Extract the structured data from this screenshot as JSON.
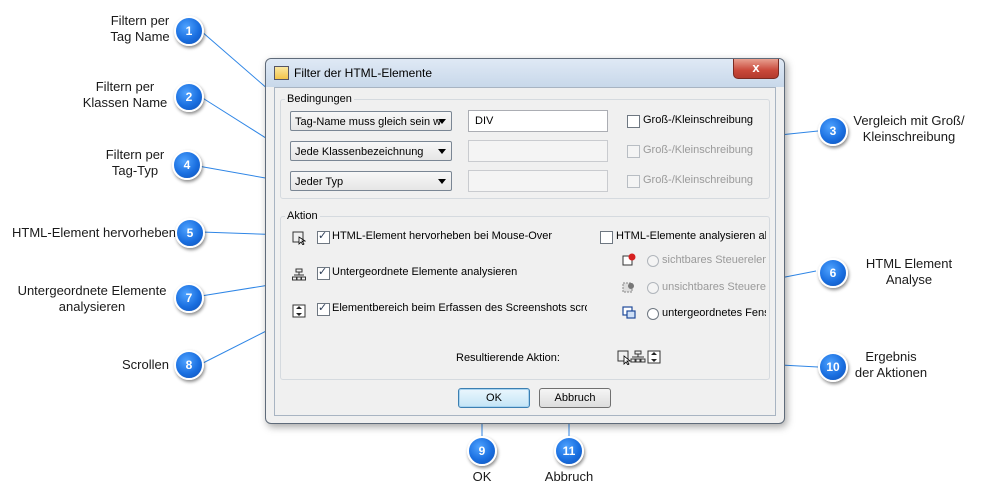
{
  "callouts": {
    "c1": {
      "num": "1",
      "label_lines": [
        "Filtern per",
        "Tag Name"
      ]
    },
    "c2": {
      "num": "2",
      "label_lines": [
        "Filtern per",
        "Klassen Name"
      ]
    },
    "c3": {
      "num": "3",
      "label_lines": [
        "Vergleich mit Groß/",
        "Kleinschreibung"
      ]
    },
    "c4": {
      "num": "4",
      "label_lines": [
        "Filtern per",
        "Tag-Typ"
      ]
    },
    "c5": {
      "num": "5",
      "label_lines": [
        "HTML-Element hervorheben"
      ]
    },
    "c6": {
      "num": "6",
      "label_lines": [
        "HTML Element",
        "Analyse"
      ]
    },
    "c7": {
      "num": "7",
      "label_lines": [
        "Untergeordnete Elemente",
        "analysieren"
      ]
    },
    "c8": {
      "num": "8",
      "label_lines": [
        "Scrollen"
      ]
    },
    "c9": {
      "num": "9",
      "label_lines": [
        "OK"
      ]
    },
    "c10": {
      "num": "10",
      "label_lines": [
        "Ergebnis",
        "der Aktionen"
      ]
    },
    "c11": {
      "num": "11",
      "label_lines": [
        "Abbruch"
      ]
    }
  },
  "dialog": {
    "title": "Filter der HTML-Elemente",
    "close_label": "x",
    "conditions": {
      "legend": "Bedingungen",
      "tag_combo": "Tag-Name muss gleich sein w",
      "tag_value": "DIV",
      "class_combo": "Jede Klassenbezeichnung",
      "class_value": "",
      "type_combo": "Jeder Typ",
      "type_value": "",
      "case_label_1": "Groß-/Kleinschreibung",
      "case_label_2": "Groß-/Kleinschreibung",
      "case_label_3": "Groß-/Kleinschreibung"
    },
    "action": {
      "legend": "Aktion",
      "highlight_label": "HTML-Element hervorheben bei Mouse-Over",
      "children_label": "Untergeordnete Elemente analysieren",
      "scroll_label": "Elementbereich beim Erfassen des Screenshots scrolle",
      "analyze_label": "HTML-Elemente analysieren al",
      "radio_visible": "sichtbares Steuerelem",
      "radio_invisible": "unsichtbares Steuerele",
      "radio_child": "untergeordnetes Fens",
      "result_label": "Resultierende Aktion:"
    },
    "buttons": {
      "ok": "OK",
      "cancel": "Abbruch"
    }
  },
  "colors": {
    "badge": "#1a6fe0",
    "leader_line": "#2f86e6"
  }
}
